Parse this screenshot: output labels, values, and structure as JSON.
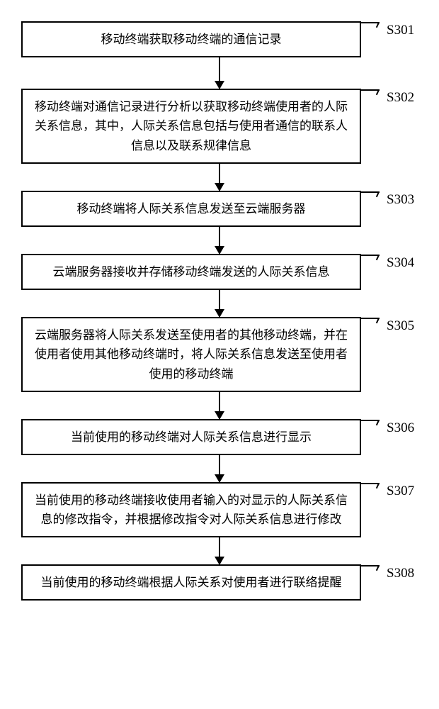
{
  "steps": [
    {
      "id": "S301",
      "text": "移动终端获取移动终端的通信记录",
      "arrowHeight": 44
    },
    {
      "id": "S302",
      "text": "移动终端对通信记录进行分析以获取移动终端使用者的人际关系信息，其中，人际关系信息包括与使用者通信的联系人信息以及联系规律信息",
      "arrowHeight": 38
    },
    {
      "id": "S303",
      "text": "移动终端将人际关系信息发送至云端服务器",
      "arrowHeight": 38
    },
    {
      "id": "S304",
      "text": "云端服务器接收并存储移动终端发送的人际关系信息",
      "arrowHeight": 38
    },
    {
      "id": "S305",
      "text": "云端服务器将人际关系发送至使用者的其他移动终端，并在使用者使用其他移动终端时，将人际关系信息发送至使用者使用的移动终端",
      "arrowHeight": 38
    },
    {
      "id": "S306",
      "text": "当前使用的移动终端对人际关系信息进行显示",
      "arrowHeight": 38
    },
    {
      "id": "S307",
      "text": "当前使用的移动终端接收使用者输入的对显示的人际关系信息的修改指令，并根据修改指令对人际关系信息进行修改",
      "arrowHeight": 38
    },
    {
      "id": "S308",
      "text": "当前使用的移动终端根据人际关系对使用者进行联络提醒",
      "arrowHeight": 0
    }
  ]
}
